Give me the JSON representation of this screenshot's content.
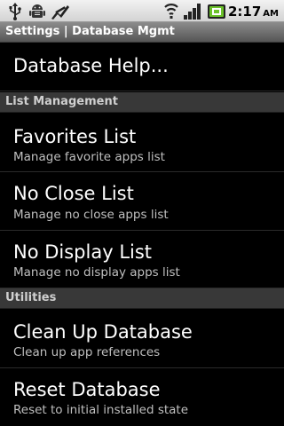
{
  "status_bar": {
    "icons": [
      "usb-icon",
      "android-debug-icon",
      "app-notification-icon",
      "wifi-icon",
      "signal-icon",
      "battery-charging-icon"
    ],
    "time": "2:17",
    "ampm": "AM"
  },
  "title_bar": {
    "title": "Settings | Database Mgmt"
  },
  "items": {
    "database_help": {
      "title": "Database Help..."
    },
    "favorites": {
      "title": "Favorites List",
      "summary": "Manage favorite apps list"
    },
    "no_close": {
      "title": "No Close List",
      "summary": "Manage no close apps list"
    },
    "no_display": {
      "title": "No Display List",
      "summary": "Manage no display apps list"
    },
    "clean_up": {
      "title": "Clean Up Database",
      "summary": "Clean up app references"
    },
    "reset": {
      "title": "Reset Database",
      "summary": "Reset to initial installed state"
    }
  },
  "categories": {
    "list_management": "List Management",
    "utilities": "Utilities"
  },
  "colors": {
    "background": "#000000",
    "category_bg": "#383838",
    "summary_text": "#bfbfbf",
    "battery_green": "#6cc22b"
  }
}
